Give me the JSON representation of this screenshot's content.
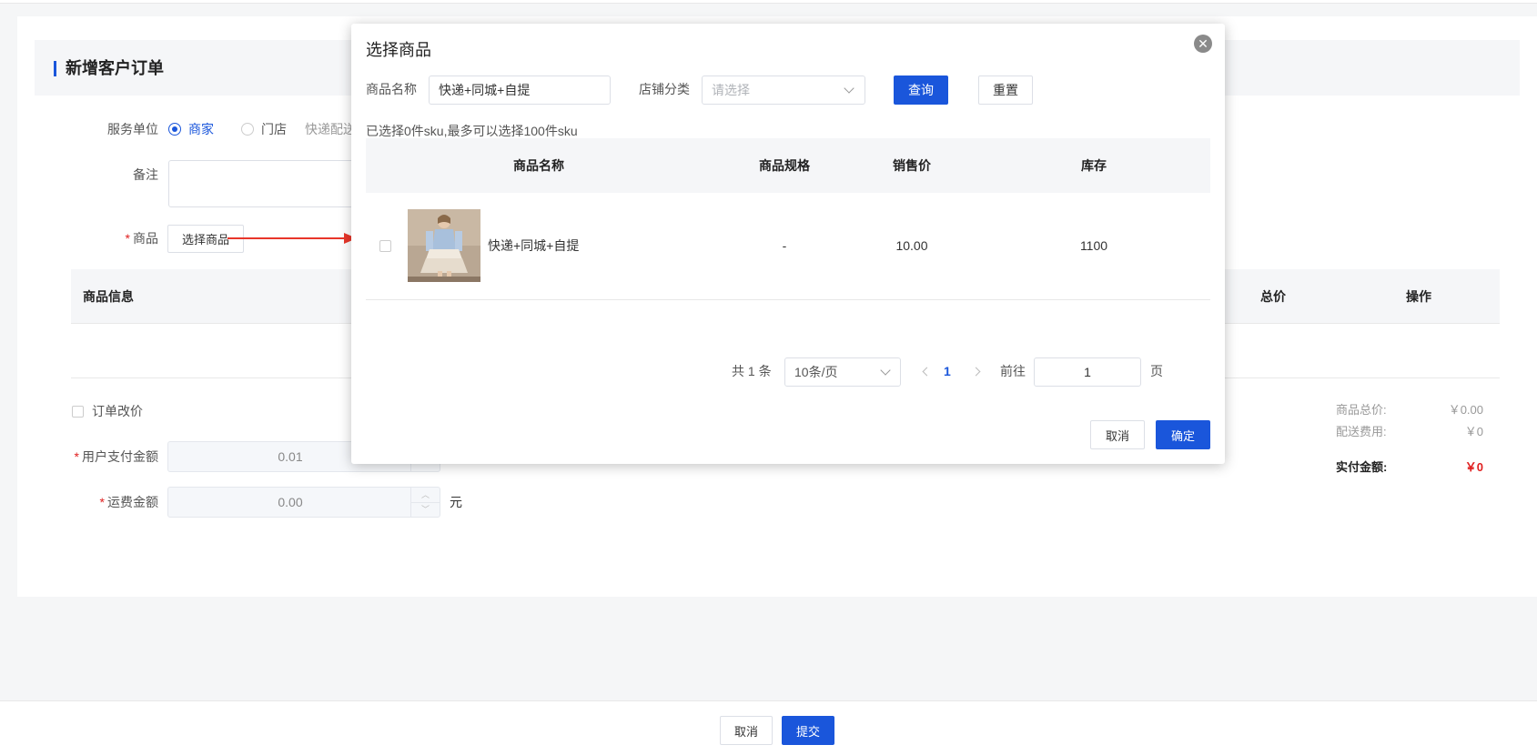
{
  "page": {
    "title": "新增客户订单",
    "service_unit_label": "服务单位",
    "service_options": [
      "商家",
      "门店"
    ],
    "service_extra": "快递配送",
    "remark_label": "备注",
    "goods_label": "商品",
    "select_goods_button": "选择商品",
    "table_headers": [
      "商品信息",
      "总价",
      "操作"
    ],
    "order_price_change": "订单改价",
    "user_pay_label": "用户支付金额",
    "user_pay_value": "0.01",
    "freight_label": "运费金额",
    "freight_value": "0.00",
    "freight_unit": "元",
    "summary": {
      "goods_total_label": "商品总价:",
      "goods_total_value": "￥0.00",
      "delivery_fee_label": "配送费用:",
      "delivery_fee_value": "￥0",
      "actual_pay_label": "实付金额:",
      "actual_pay_value": "￥0"
    },
    "footer": {
      "cancel": "取消",
      "submit": "提交"
    }
  },
  "modal": {
    "title": "选择商品",
    "name_label": "商品名称",
    "name_value": "快递+同城+自提",
    "category_label": "店铺分类",
    "category_placeholder": "请选择",
    "query_button": "查询",
    "reset_button": "重置",
    "selection_hint": "已选择0件sku,最多可以选择100件sku",
    "columns": [
      "商品名称",
      "商品规格",
      "销售价",
      "库存"
    ],
    "rows": [
      {
        "name": "快递+同城+自提",
        "spec": "-",
        "price": "10.00",
        "stock": "1100"
      }
    ],
    "pagination": {
      "total": "共 1 条",
      "page_size": "10条/页",
      "current_page": "1",
      "goto_label": "前往",
      "goto_value": "1",
      "page_suffix": "页"
    },
    "cancel_button": "取消",
    "confirm_button": "确定"
  },
  "colors": {
    "primary": "#1a56db",
    "danger": "#e02020",
    "arrow": "#e8362a"
  }
}
